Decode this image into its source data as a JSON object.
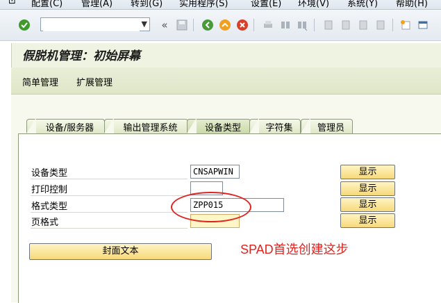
{
  "menu": [
    "配置(C)",
    "管理(A)",
    "转到(G)",
    "实用程序(S)",
    "设置(E)",
    "环境(V)",
    "系统(Y)",
    "帮助(H)"
  ],
  "toolbar": {
    "command_value": "",
    "icons": [
      "enter-icon",
      "history-arrow-icon",
      "save-icon",
      "back-icon",
      "exit-icon",
      "cancel-icon",
      "print-icon",
      "find-icon",
      "find-next-icon",
      "first-page-icon",
      "prev-page-icon",
      "next-page-icon",
      "last-page-icon",
      "create-session-icon",
      "shortcut-icon"
    ]
  },
  "title": "假脱机管理：初始屏幕",
  "app_toolbar": {
    "simple": "简单管理",
    "extended": "扩展管理"
  },
  "tabs": [
    {
      "label": "设备/服务器",
      "active": false
    },
    {
      "label": "输出管理系统",
      "active": false
    },
    {
      "label": "设备类型",
      "active": true
    },
    {
      "label": "字符集",
      "active": false
    },
    {
      "label": "管理员",
      "active": false
    }
  ],
  "form": {
    "rows": [
      {
        "label": "设备类型",
        "value": "CNSAPWIN",
        "button": "显示"
      },
      {
        "label": "打印控制",
        "value": "",
        "button": "显示"
      },
      {
        "label": "格式类型",
        "value": "ZPP015",
        "button": "显示"
      },
      {
        "label": "页格式",
        "value": "",
        "button": "显示"
      }
    ],
    "cover_button": "封面文本"
  },
  "annotation": "SPAD首选创建这步",
  "colors": {
    "annotation": "#e0241f",
    "button": "#f6d97a",
    "background": "#eff3e2"
  }
}
